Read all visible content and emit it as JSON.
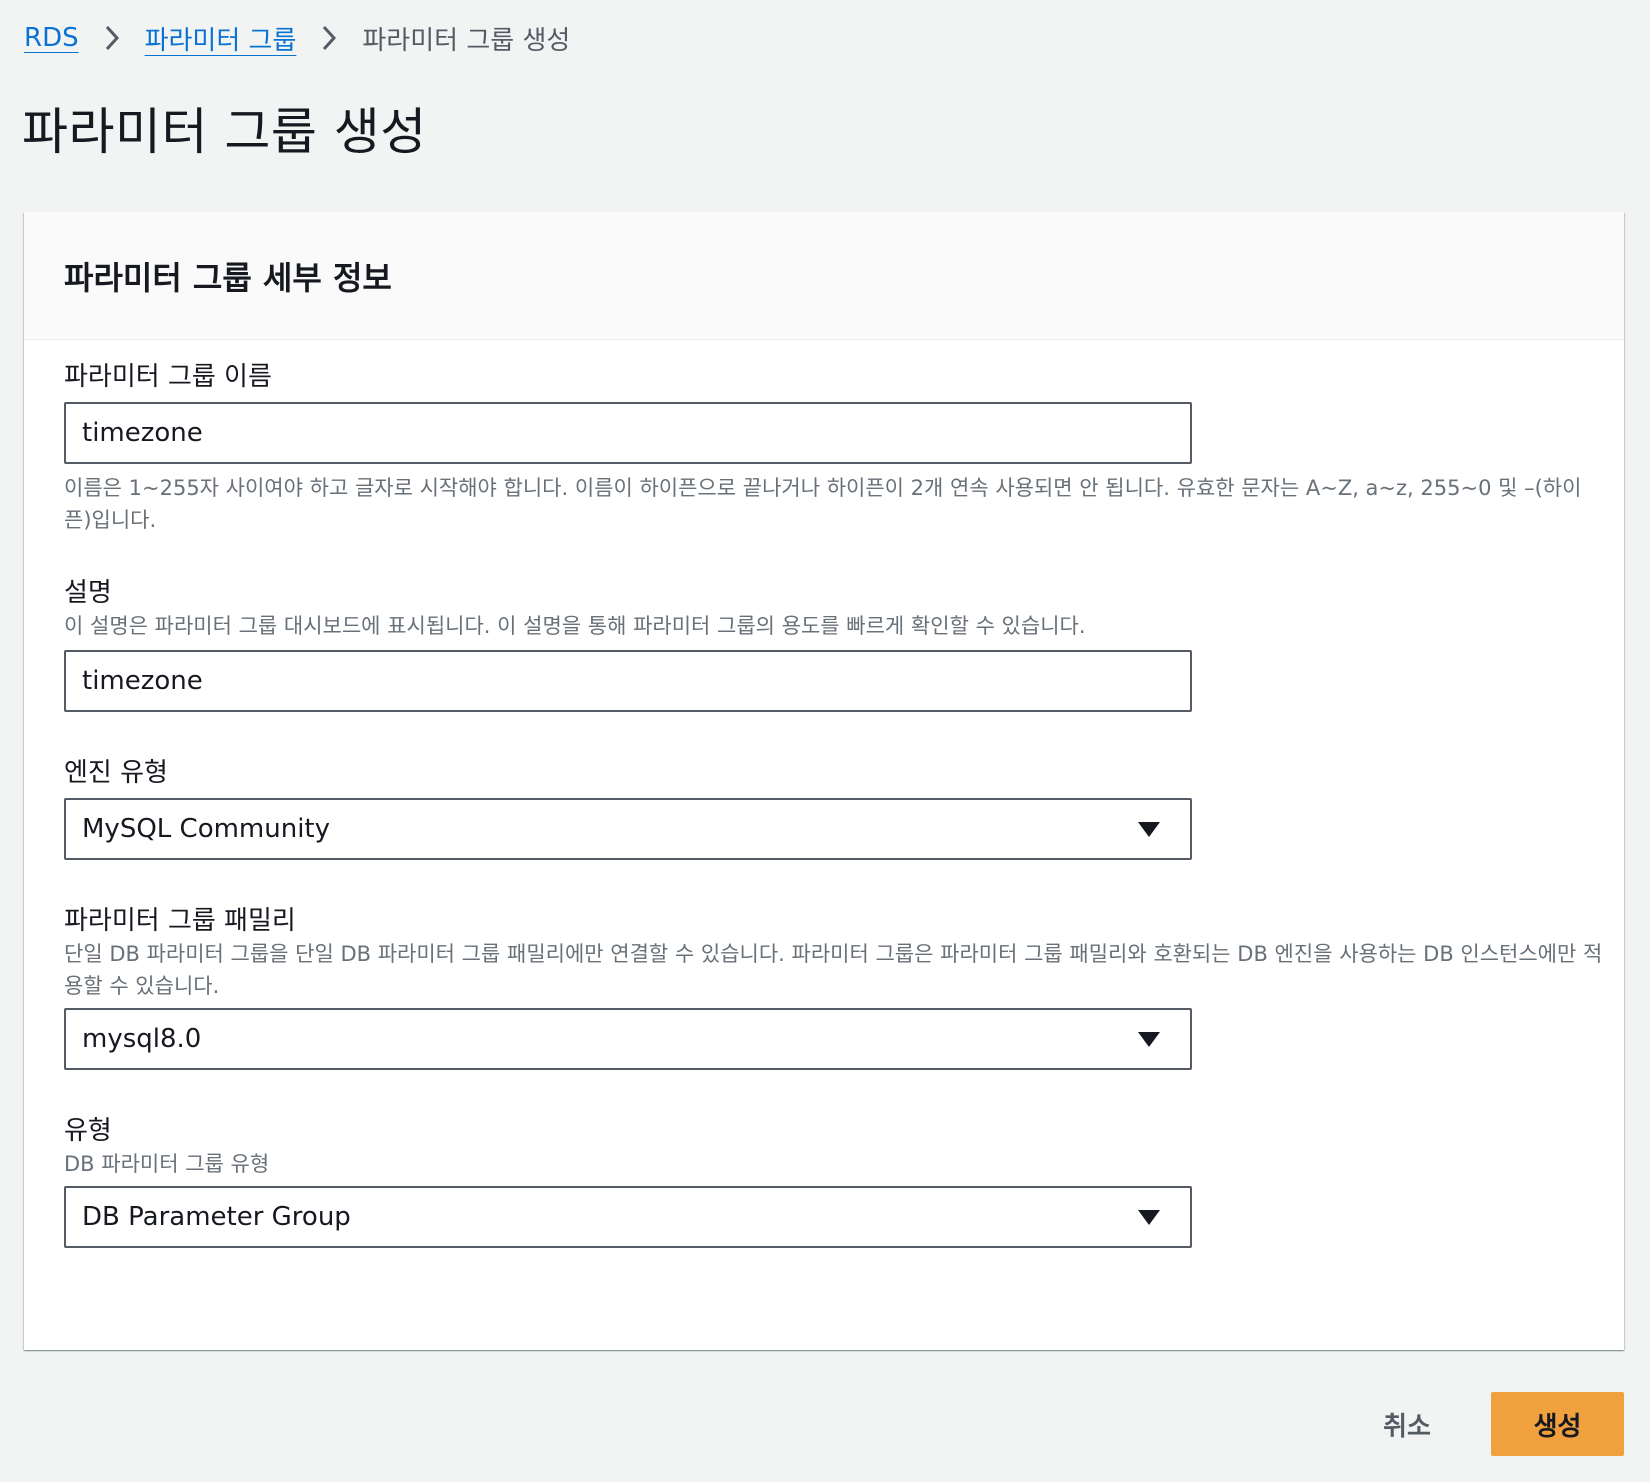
{
  "breadcrumb": {
    "items": [
      {
        "label": "RDS"
      },
      {
        "label": "파라미터 그룹"
      },
      {
        "label": "파라미터 그룹 생성"
      }
    ]
  },
  "page": {
    "title": "파라미터 그룹 생성"
  },
  "card": {
    "title": "파라미터 그룹 세부 정보"
  },
  "form": {
    "name": {
      "label": "파라미터 그룹 이름",
      "value": "timezone",
      "constraint": "이름은 1~255자 사이여야 하고 글자로 시작해야 합니다. 이름이 하이픈으로 끝나거나 하이픈이 2개 연속 사용되면 안 됩니다. 유효한 문자는 A~Z, a~z, 255~0 및 –(하이픈)입니다."
    },
    "description": {
      "label": "설명",
      "help": "이 설명은 파라미터 그룹 대시보드에 표시됩니다. 이 설명을 통해 파라미터 그룹의 용도를 빠르게 확인할 수 있습니다.",
      "value": "timezone"
    },
    "engine_type": {
      "label": "엔진 유형",
      "value": "MySQL Community"
    },
    "family": {
      "label": "파라미터 그룹 패밀리",
      "help": "단일 DB 파라미터 그룹을 단일 DB 파라미터 그룹 패밀리에만 연결할 수 있습니다. 파라미터 그룹은 파라미터 그룹 패밀리와 호환되는 DB 엔진을 사용하는 DB 인스턴스에만 적용할 수 있습니다.",
      "value": "mysql8.0"
    },
    "type": {
      "label": "유형",
      "help": "DB 파라미터 그룹 유형",
      "value": "DB Parameter Group"
    }
  },
  "actions": {
    "cancel_label": "취소",
    "create_label": "생성"
  }
}
